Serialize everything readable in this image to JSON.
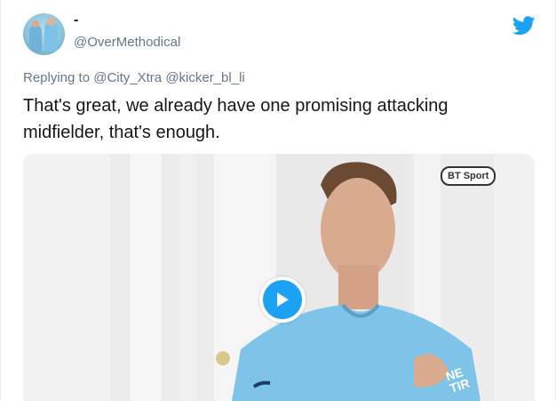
{
  "user": {
    "display_name": "-",
    "handle": "@OverMethodical"
  },
  "reply": {
    "prefix": "Replying to",
    "mentions": [
      "@City_Xtra",
      "@kicker_bl_li"
    ]
  },
  "tweet": {
    "text": "That's great, we already have one promising attacking midfielder, that's enough."
  },
  "media": {
    "watermark": "BT Sport",
    "shirt_text": "NE\nTIR"
  },
  "colors": {
    "accent": "#1da1f2",
    "secondary_text": "#657786",
    "primary_text": "#14171a"
  },
  "icons": {
    "logo": "twitter-bird-icon",
    "play": "play-icon"
  }
}
